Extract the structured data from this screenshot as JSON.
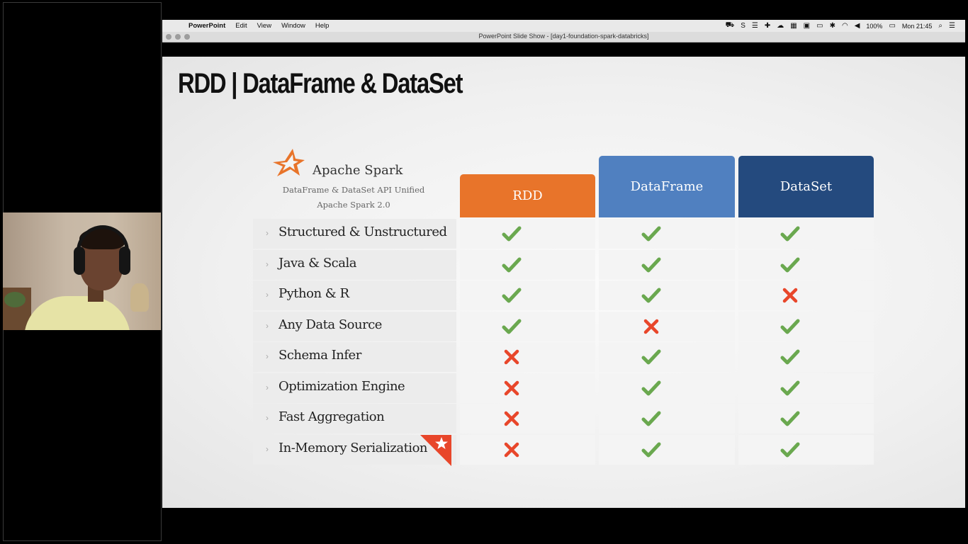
{
  "menubar": {
    "app": "PowerPoint",
    "items": [
      "Edit",
      "View",
      "Window",
      "Help"
    ],
    "battery": "100%",
    "clock": "Mon 21:45"
  },
  "window": {
    "title": "PowerPoint Slide Show - [day1-foundation-spark-databricks]"
  },
  "slide": {
    "title": "RDD | DataFrame & DataSet",
    "brand": {
      "name": "Apache Spark",
      "subtitle_line1": "DataFrame & DataSet API Unified",
      "subtitle_line2": "Apache Spark 2.0"
    },
    "columns": [
      "RDD",
      "DataFrame",
      "DataSet"
    ],
    "rows": [
      {
        "label": "Structured & Unstructured",
        "values": [
          "check",
          "check",
          "check"
        ]
      },
      {
        "label": "Java & Scala",
        "values": [
          "check",
          "check",
          "check"
        ]
      },
      {
        "label": "Python & R",
        "values": [
          "check",
          "check",
          "cross"
        ]
      },
      {
        "label": "Any Data Source",
        "values": [
          "check",
          "cross",
          "check"
        ]
      },
      {
        "label": "Schema Infer",
        "values": [
          "cross",
          "check",
          "check"
        ]
      },
      {
        "label": "Optimization Engine",
        "values": [
          "cross",
          "check",
          "check"
        ]
      },
      {
        "label": "Fast Aggregation",
        "values": [
          "cross",
          "check",
          "check"
        ]
      },
      {
        "label": "In-Memory Serialization",
        "values": [
          "cross",
          "check",
          "check"
        ]
      }
    ],
    "colors": {
      "check": "#6aa84f",
      "cross": "#e8462a",
      "rdd": "#e8742a",
      "dataframe": "#5080c0",
      "dataset": "#244a7e"
    }
  }
}
